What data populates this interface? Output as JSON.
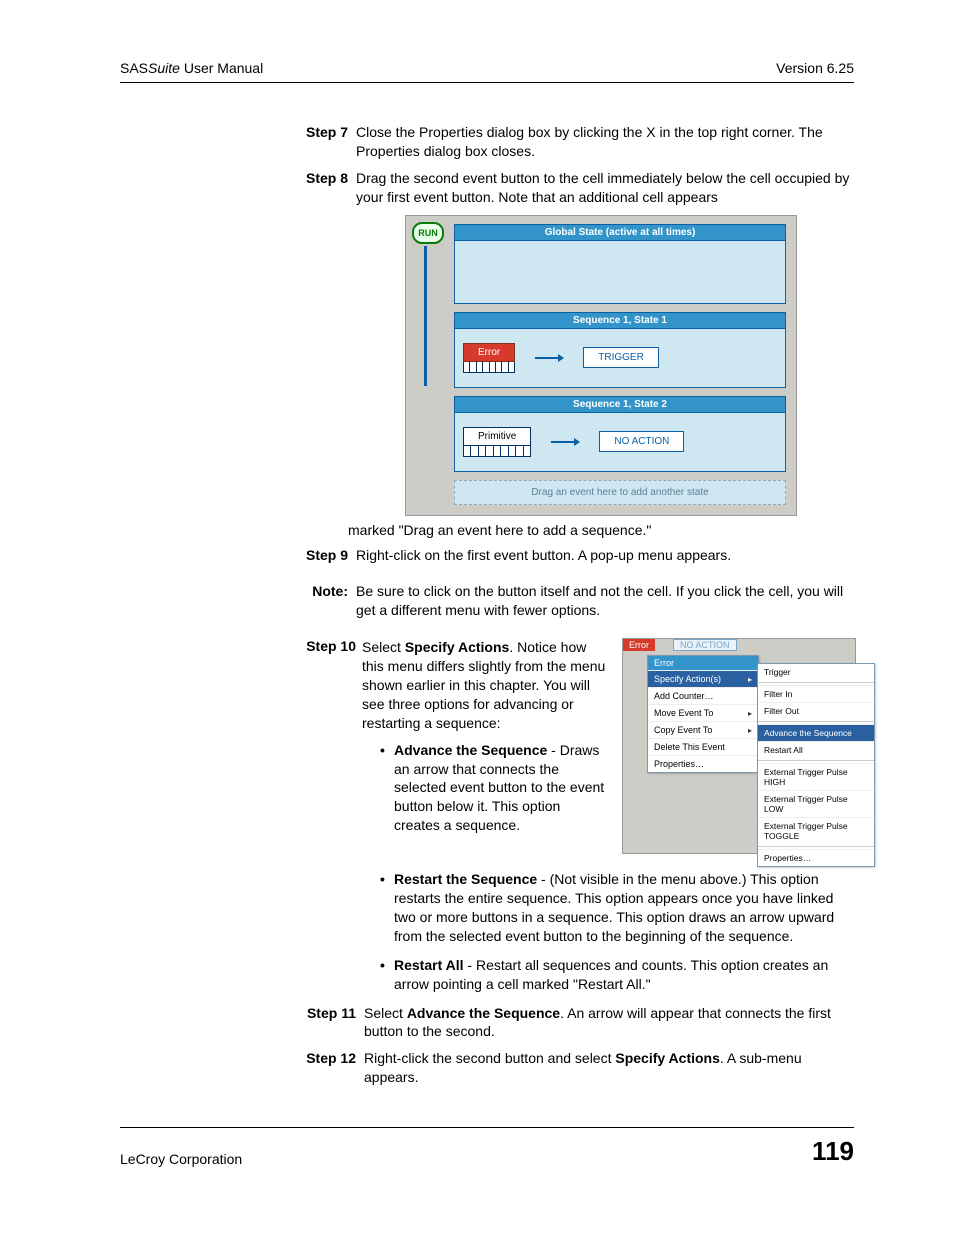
{
  "header": {
    "product": "SAS",
    "suite": "Suite",
    "manual": " User Manual",
    "version": "Version 6.25"
  },
  "step7": {
    "label": "Step 7",
    "text": "Close the Properties dialog box by clicking the X in the top right corner.  The Properties dialog box closes."
  },
  "step8": {
    "label": "Step 8",
    "text": "Drag the second event button to the cell immediately below the cell occupied by your first event button.  Note that an additional cell appears"
  },
  "fig1": {
    "run": "RUN",
    "global_title": "Global State (active at all times)",
    "seq1_title": "Sequence 1, State 1",
    "seq1_event": "Error",
    "seq1_action": "TRIGGER",
    "seq2_title": "Sequence 1, State 2",
    "seq2_event": "Primitive",
    "seq2_action": "NO ACTION",
    "drop_hint": "Drag an event here to add another state"
  },
  "caption_after_fig1": "marked \"Drag an event here to add a sequence.\"",
  "step9": {
    "label": "Step 9",
    "text": "Right-click on the first event button.  A pop-up menu appears."
  },
  "note": {
    "label": "Note:",
    "text": "Be sure to click on the button itself and not the cell.  If you click the cell, you will get a different menu with fewer options."
  },
  "step10": {
    "label": "Step 10",
    "intro_a": "Select ",
    "intro_bold": "Specify Actions",
    "intro_b": ".  Notice how this menu differs slightly from the menu shown earlier in this chapter.  You will see three options for advancing or restarting a sequence:"
  },
  "fig2": {
    "err": "Error",
    "noaction": "NO ACTION",
    "menu_title": "Error",
    "m_specify": "Specify Action(s)",
    "m_addcounter": "Add Counter…",
    "m_move": "Move Event To",
    "m_copy": "Copy Event To",
    "m_delete": "Delete This Event",
    "m_props": "Properties…",
    "s_trigger": "Trigger",
    "s_filterin": "Filter In",
    "s_filterout": "Filter Out",
    "s_advance": "Advance the Sequence",
    "s_restartall": "Restart All",
    "s_high": "External Trigger Pulse HIGH",
    "s_low": "External Trigger Pulse LOW",
    "s_toggle": "External Trigger Pulse TOGGLE",
    "s_props": "Properties…"
  },
  "bullets": {
    "b1_bold": "Advance the Sequence",
    "b1_rest": " - Draws an arrow that connects the selected event button to the event button below it.  This option creates a sequence.",
    "b2_bold": "Restart the Sequence",
    "b2_rest": " - (Not visible in the menu above.)  This option restarts the entire sequence.  This option appears once you have linked two or more buttons in a sequence.  This option  draws an arrow upward from the selected event button to the beginning of the sequence.",
    "b3_bold": "Restart All",
    "b3_rest": " - Restart all sequences and counts.  This option creates an arrow pointing a cell marked \"Restart All.\""
  },
  "step11": {
    "label": "Step 11",
    "a": "Select ",
    "bold": "Advance the Sequence",
    "b": ".  An arrow will appear that connects the first button to the second."
  },
  "step12": {
    "label": "Step 12",
    "a": "Right-click the second button and select ",
    "bold": "Specify Actions",
    "b": ".  A sub-menu appears."
  },
  "footer": {
    "company": "LeCroy Corporation",
    "page": "119"
  }
}
